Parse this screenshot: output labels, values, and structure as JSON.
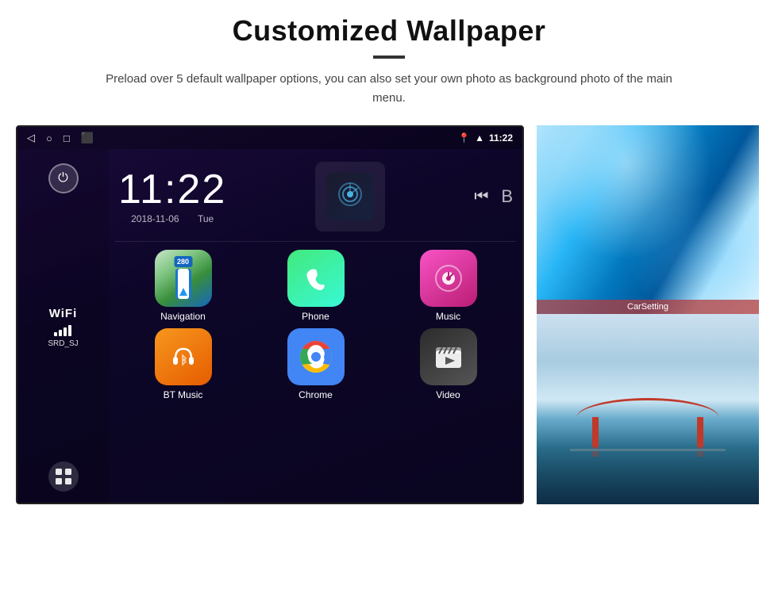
{
  "header": {
    "title": "Customized Wallpaper",
    "subtitle": "Preload over 5 default wallpaper options, you can also set your own photo as background photo of the main menu."
  },
  "android": {
    "statusBar": {
      "time": "11:22",
      "icons": [
        "back",
        "home",
        "recent",
        "screenshot"
      ]
    },
    "clock": {
      "time": "11:22",
      "date": "2018-11-06",
      "day": "Tue"
    },
    "wifi": {
      "label": "WiFi",
      "ssid": "SRD_SJ"
    },
    "apps": [
      {
        "name": "Navigation",
        "type": "navigation"
      },
      {
        "name": "Phone",
        "type": "phone"
      },
      {
        "name": "Music",
        "type": "music"
      },
      {
        "name": "BT Music",
        "type": "bt"
      },
      {
        "name": "Chrome",
        "type": "chrome"
      },
      {
        "name": "Video",
        "type": "video"
      }
    ],
    "mediaControls": [
      "skip-back",
      "bluetooth"
    ],
    "carSetting": "CarSetting"
  },
  "wallpapers": [
    {
      "name": "ice-cave",
      "label": "Ice Cave"
    },
    {
      "name": "golden-gate",
      "label": "Golden Gate Bridge"
    }
  ]
}
